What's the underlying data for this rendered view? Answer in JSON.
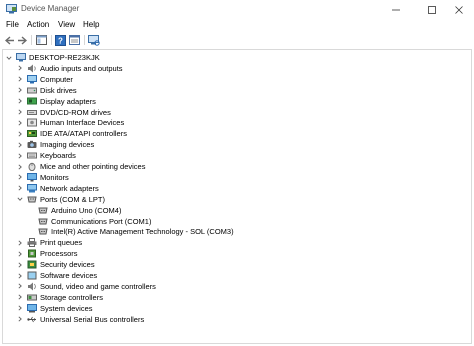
{
  "window": {
    "title": "Device Manager"
  },
  "menu": [
    "File",
    "Action",
    "View",
    "Help"
  ],
  "toolbar": {
    "buttons": [
      "back-icon",
      "forward-icon",
      "show-hide-console-tree-icon",
      "help-icon",
      "properties-icon",
      "scan-hardware-icon"
    ]
  },
  "tree": {
    "root": "DESKTOP-RE23KJK",
    "categories": [
      {
        "label": "Audio inputs and outputs",
        "icon": "speaker-icon",
        "expanded": false
      },
      {
        "label": "Computer",
        "icon": "computer-icon",
        "expanded": false
      },
      {
        "label": "Disk drives",
        "icon": "disk-drive-icon",
        "expanded": false
      },
      {
        "label": "Display adapters",
        "icon": "display-adapter-icon",
        "expanded": false
      },
      {
        "label": "DVD/CD-ROM drives",
        "icon": "dvd-drive-icon",
        "expanded": false
      },
      {
        "label": "Human Interface Devices",
        "icon": "hid-icon",
        "expanded": false
      },
      {
        "label": "IDE ATA/ATAPI controllers",
        "icon": "ide-controller-icon",
        "expanded": false
      },
      {
        "label": "Imaging devices",
        "icon": "camera-icon",
        "expanded": false
      },
      {
        "label": "Keyboards",
        "icon": "keyboard-icon",
        "expanded": false
      },
      {
        "label": "Mice and other pointing devices",
        "icon": "mouse-icon",
        "expanded": false
      },
      {
        "label": "Monitors",
        "icon": "monitor-icon",
        "expanded": false
      },
      {
        "label": "Network adapters",
        "icon": "network-adapter-icon",
        "expanded": false
      },
      {
        "label": "Ports (COM & LPT)",
        "icon": "port-icon",
        "expanded": true,
        "children": [
          "Arduino Uno (COM4)",
          "Communications Port (COM1)",
          "Intel(R) Active Management Technology - SOL (COM3)"
        ]
      },
      {
        "label": "Print queues",
        "icon": "printer-icon",
        "expanded": false
      },
      {
        "label": "Processors",
        "icon": "processor-icon",
        "expanded": false
      },
      {
        "label": "Security devices",
        "icon": "security-device-icon",
        "expanded": false
      },
      {
        "label": "Software devices",
        "icon": "software-device-icon",
        "expanded": false
      },
      {
        "label": "Sound, video and game controllers",
        "icon": "sound-controller-icon",
        "expanded": false
      },
      {
        "label": "Storage controllers",
        "icon": "storage-controller-icon",
        "expanded": false
      },
      {
        "label": "System devices",
        "icon": "system-device-icon",
        "expanded": false
      },
      {
        "label": "Universal Serial Bus controllers",
        "icon": "usb-icon",
        "expanded": false
      }
    ]
  },
  "colors": {
    "accent": "#2b6cb0",
    "border": "#d9d9d9",
    "chevron": "#606060"
  }
}
